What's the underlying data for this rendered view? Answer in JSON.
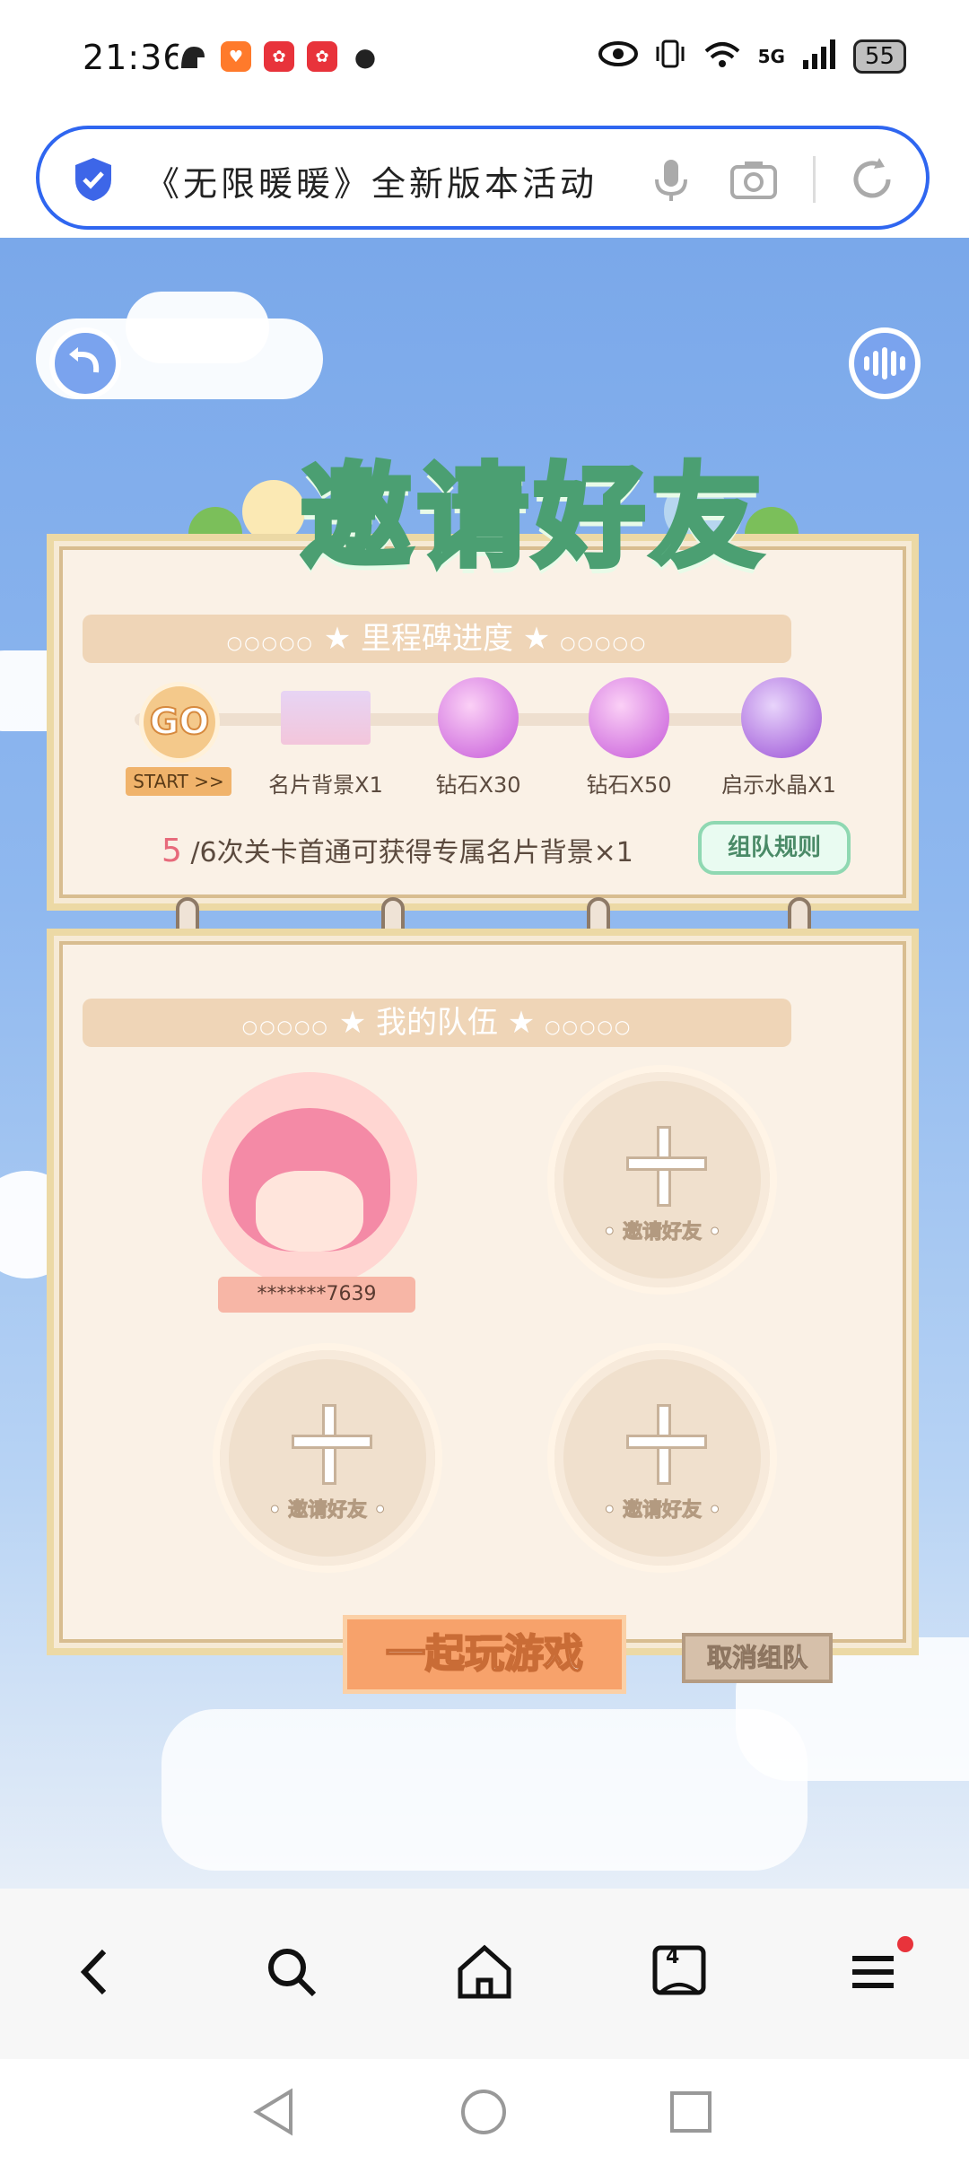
{
  "status_bar": {
    "time": "21:36",
    "network": "5G",
    "battery": "55"
  },
  "browser": {
    "url_text": "《无限暖暖》全新版本活动"
  },
  "game": {
    "title": "邀请好友",
    "milestone_header": "里程碑进度",
    "milestones": [
      {
        "label": "名片背景X1"
      },
      {
        "label": "钻石X30"
      },
      {
        "label": "钻石X50"
      },
      {
        "label": "启示水晶X1"
      }
    ],
    "go_badge": "GO",
    "start_label": "START >>",
    "progress_count": "5",
    "progress_text": "/6次关卡首通可获得专属名片背景×1",
    "rule_button": "组队规则",
    "team_header": "我的队伍",
    "member_name": "*******7639",
    "invite_label": "• 邀请好友 •",
    "play_button": "一起玩游戏",
    "cancel_button": "取消组队"
  },
  "toolbar": {
    "tab_count": "4"
  },
  "colors": {
    "accent_blue": "#2f66f0",
    "title_green": "#79d3a0",
    "play_orange": "#f7a26b"
  }
}
